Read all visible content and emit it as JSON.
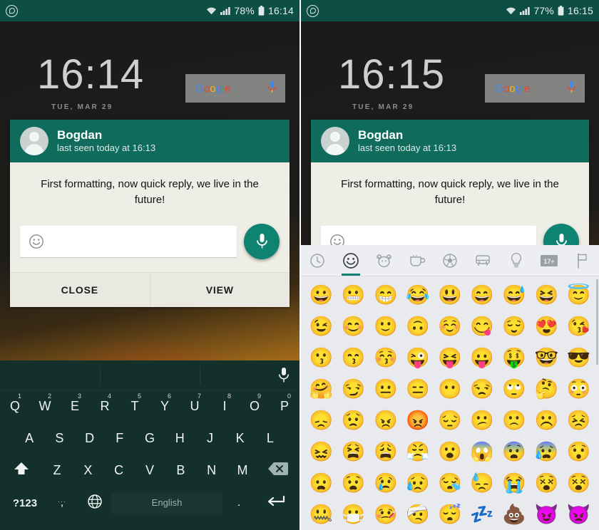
{
  "panels": [
    {
      "id": "left",
      "status": {
        "app_icon": "whatsapp-icon",
        "wifi_icon": "wifi-icon",
        "signal_icon": "cell-signal-icon",
        "battery_percent": "78%",
        "battery_icon": "battery-icon",
        "clock": "16:14"
      },
      "lockscreen": {
        "clock": "16:14",
        "date": "TUE, MAR 29",
        "google_widget": {
          "logo_letters": [
            "G",
            "o",
            "o",
            "g",
            "l",
            "e"
          ],
          "mic_icon": "microphone-icon"
        }
      },
      "notification": {
        "avatar_icon": "contact-avatar-icon",
        "title": "Bogdan",
        "subtitle": "last seen today at 16:13",
        "message": "First formatting, now quick reply, we live in the future!",
        "reply": {
          "placeholder": "",
          "value": "",
          "emoji_icon": "smiley-face-icon",
          "mic_icon": "microphone-icon"
        },
        "actions": [
          "CLOSE",
          "VIEW"
        ]
      },
      "keyboard": {
        "visible": true,
        "mic_icon": "microphone-icon",
        "row1": [
          {
            "letter": "Q",
            "num": "1"
          },
          {
            "letter": "W",
            "num": "2"
          },
          {
            "letter": "E",
            "num": "3"
          },
          {
            "letter": "R",
            "num": "4"
          },
          {
            "letter": "T",
            "num": "5"
          },
          {
            "letter": "Y",
            "num": "6"
          },
          {
            "letter": "U",
            "num": "7"
          },
          {
            "letter": "I",
            "num": "8"
          },
          {
            "letter": "O",
            "num": "9"
          },
          {
            "letter": "P",
            "num": "0"
          }
        ],
        "row2": [
          "A",
          "S",
          "D",
          "F",
          "G",
          "H",
          "J",
          "K",
          "L"
        ],
        "row3_letters": [
          "Z",
          "X",
          "C",
          "V",
          "B",
          "N",
          "M"
        ],
        "shift_icon": "shift-up-arrow-icon",
        "backspace_icon": "backspace-icon",
        "bottom": {
          "symbols": "?123",
          "comma": ",",
          "comma_dots": "···",
          "globe_icon": "globe-language-icon",
          "space_label": "English",
          "period": ".",
          "enter_icon": "enter-return-icon"
        }
      },
      "emoji_panel": {
        "visible": false
      }
    },
    {
      "id": "right",
      "status": {
        "app_icon": "whatsapp-icon",
        "wifi_icon": "wifi-icon",
        "signal_icon": "cell-signal-icon",
        "battery_percent": "77%",
        "battery_icon": "battery-icon",
        "clock": "16:15"
      },
      "lockscreen": {
        "clock": "16:15",
        "date": "TUE, MAR 29",
        "google_widget": {
          "logo_letters": [
            "G",
            "o",
            "o",
            "g",
            "l",
            "e"
          ],
          "mic_icon": "microphone-icon"
        }
      },
      "notification": {
        "avatar_icon": "contact-avatar-icon",
        "title": "Bogdan",
        "subtitle": "last seen today at 16:13",
        "message": "First formatting, now quick reply, we live in the future!",
        "reply": {
          "placeholder": "",
          "value": "",
          "emoji_icon": "smiley-face-icon",
          "mic_icon": "microphone-icon"
        },
        "actions": []
      },
      "keyboard": {
        "visible": false
      },
      "emoji_panel": {
        "visible": true,
        "tabs": [
          {
            "name": "recent-clock-icon",
            "glyph": "○",
            "active": false
          },
          {
            "name": "smileys-icon",
            "glyph": "☺",
            "active": true
          },
          {
            "name": "animals-icon",
            "glyph": "●",
            "active": false
          },
          {
            "name": "food-drink-icon",
            "glyph": "☕",
            "active": false
          },
          {
            "name": "sports-icon",
            "glyph": "⚽",
            "active": false
          },
          {
            "name": "travel-car-icon",
            "glyph": "🚌",
            "active": false
          },
          {
            "name": "objects-bulb-icon",
            "glyph": "💡",
            "active": false
          },
          {
            "name": "symbols-icon",
            "glyph": "17+",
            "active": false
          },
          {
            "name": "flags-icon",
            "glyph": "⚑",
            "active": false
          }
        ],
        "emojis": [
          "😀",
          "😬",
          "😁",
          "😂",
          "😃",
          "😄",
          "😅",
          "😆",
          "😇",
          "😉",
          "😊",
          "🙂",
          "🙃",
          "☺️",
          "😋",
          "😌",
          "😍",
          "😘",
          "😗",
          "😙",
          "😚",
          "😜",
          "😝",
          "😛",
          "🤑",
          "🤓",
          "😎",
          "🤗",
          "😏",
          "😐",
          "😑",
          "😶",
          "😒",
          "🙄",
          "🤔",
          "😳",
          "😞",
          "😟",
          "😠",
          "😡",
          "😔",
          "😕",
          "🙁",
          "☹️",
          "😣",
          "😖",
          "😫",
          "😩",
          "😤",
          "😮",
          "😱",
          "😨",
          "😰",
          "😯",
          "😦",
          "😧",
          "😢",
          "😥",
          "😪",
          "😓",
          "😭",
          "😵",
          "😵",
          "🤐",
          "😷",
          "🤒",
          "🤕",
          "😴",
          "💤",
          "💩",
          "😈",
          "👿"
        ]
      }
    }
  ],
  "dock_folders": [
    {
      "name": "folder-1",
      "tiles": [
        "#c8253a",
        "#cf1f21",
        "#1a9c4a",
        "#e0a613"
      ]
    },
    {
      "name": "folder-2",
      "tiles": [
        "#2a9d4f",
        "#2d6fd4",
        "#1f73c4",
        "#4b9fd5"
      ]
    },
    {
      "name": "folder-3",
      "tiles": [
        "#6bbf4a",
        "#33a06f",
        "#d64b3a",
        "#e8a42c"
      ]
    },
    {
      "name": "folder-4",
      "tiles": [
        "#4b8f3f",
        "#1a4fa0",
        "#333333",
        "#18a04b"
      ]
    },
    {
      "name": "folder-5",
      "tiles": [
        "#7b3fa0",
        "#e23b3b",
        "#4a4a4a",
        "#2f9b55"
      ]
    }
  ],
  "theme": {
    "whatsapp_dark_teal": "#0d4f44",
    "whatsapp_header_teal": "#0f6b5c",
    "accent_teal": "#0f8372",
    "keyboard_bg": "#13302a",
    "emoji_panel_bg": "#e8eaee",
    "notification_bg": "#eeeee6",
    "wallpaper_red": "#a93818",
    "wallpaper_gold": "#b5761a"
  }
}
